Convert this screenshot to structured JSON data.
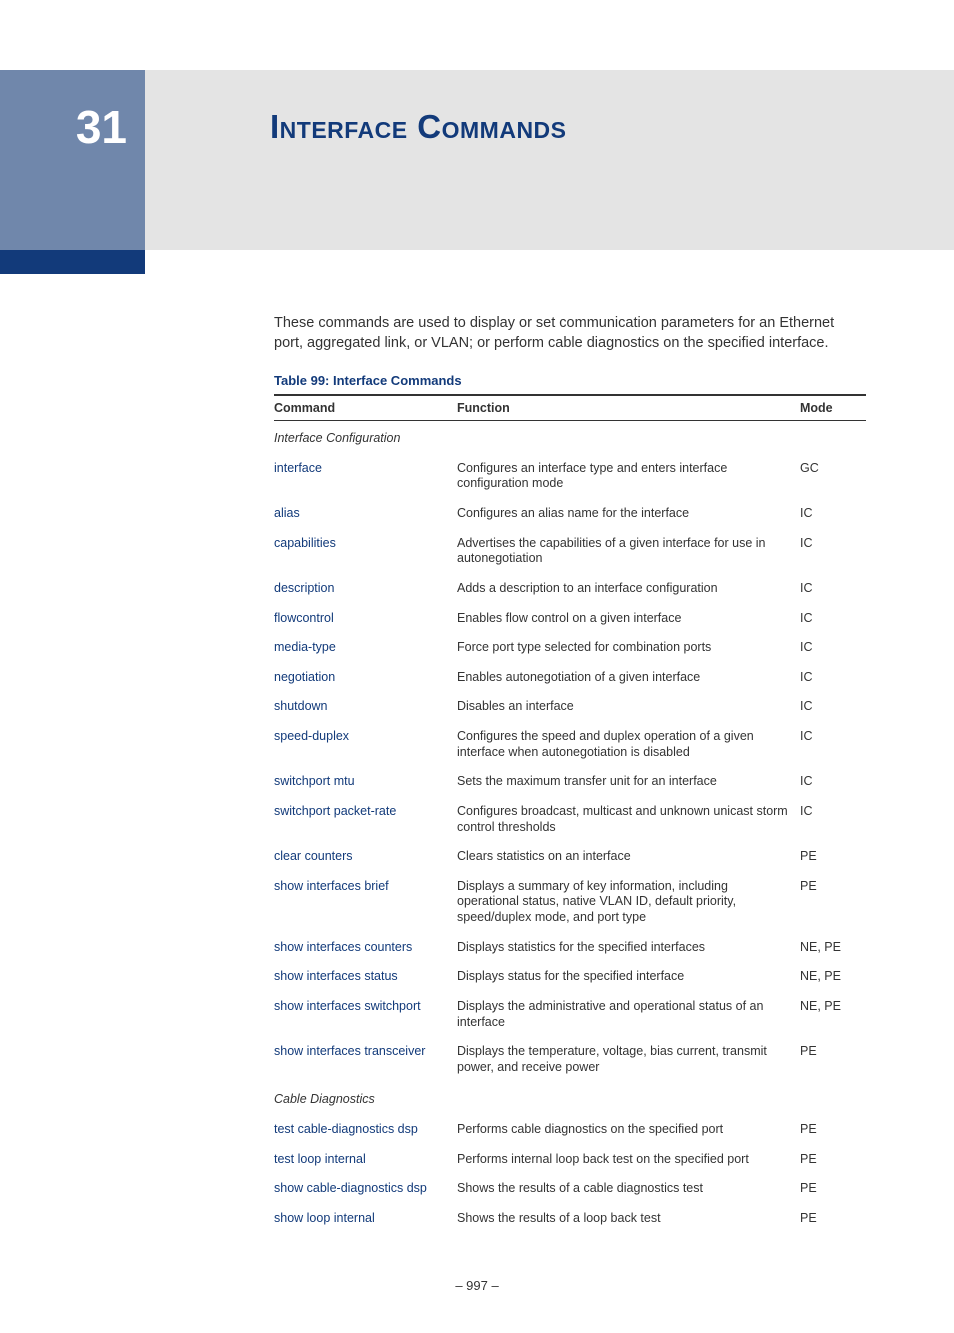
{
  "chapter": {
    "number": "31",
    "title": "Interface Commands"
  },
  "intro": "These commands are used to display or set communication parameters for an Ethernet port, aggregated link, or VLAN; or perform cable diagnostics on the specified interface.",
  "table": {
    "caption": "Table 99: Interface Commands",
    "headers": {
      "command": "Command",
      "function": "Function",
      "mode": "Mode"
    },
    "sections": [
      {
        "title": "Interface Configuration",
        "rows": [
          {
            "command": "interface",
            "function": "Configures an interface type and enters interface configuration mode",
            "mode": "GC"
          },
          {
            "command": "alias",
            "function": "Configures an alias name for the interface",
            "mode": "IC"
          },
          {
            "command": "capabilities",
            "function": "Advertises the capabilities of a given interface for use in autonegotiation",
            "mode": "IC"
          },
          {
            "command": "description",
            "function": "Adds a description to an interface configuration",
            "mode": "IC"
          },
          {
            "command": "flowcontrol",
            "function": "Enables flow control on a given interface",
            "mode": "IC"
          },
          {
            "command": "media-type",
            "function": "Force port type selected for combination ports",
            "mode": "IC"
          },
          {
            "command": "negotiation",
            "function": "Enables autonegotiation of a given interface",
            "mode": "IC"
          },
          {
            "command": "shutdown",
            "function": "Disables an interface",
            "mode": "IC"
          },
          {
            "command": "speed-duplex",
            "function": "Configures the speed and duplex operation of a given interface when autonegotiation is disabled",
            "mode": "IC"
          },
          {
            "command": "switchport mtu",
            "function": "Sets the maximum transfer unit for an interface",
            "mode": "IC"
          },
          {
            "command": "switchport packet-rate",
            "function": "Configures broadcast, multicast and unknown unicast storm control thresholds",
            "mode": "IC"
          },
          {
            "command": "clear counters",
            "function": "Clears statistics on an interface",
            "mode": "PE"
          },
          {
            "command": "show interfaces brief",
            "function": "Displays a summary of key information, including operational status, native VLAN ID, default priority, speed/duplex mode, and port type",
            "mode": "PE"
          },
          {
            "command": "show interfaces counters",
            "function": "Displays statistics for the specified interfaces",
            "mode": "NE, PE"
          },
          {
            "command": "show interfaces status",
            "function": "Displays status for the specified interface",
            "mode": "NE, PE"
          },
          {
            "command": "show interfaces switchport",
            "function": "Displays the administrative and operational status of an interface",
            "mode": "NE, PE"
          },
          {
            "command": "show interfaces transceiver",
            "function": "Displays the temperature, voltage, bias current, transmit power, and receive power",
            "mode": "PE"
          }
        ]
      },
      {
        "title": "Cable Diagnostics",
        "rows": [
          {
            "command": "test cable-diagnostics dsp",
            "function": "Performs cable diagnostics on the specified port",
            "mode": "PE"
          },
          {
            "command": "test loop internal",
            "function": "Performs internal loop back test on the specified port",
            "mode": "PE"
          },
          {
            "command": "show cable-diagnostics dsp",
            "function": "Shows the results of a cable diagnostics test",
            "mode": "PE"
          },
          {
            "command": "show loop internal",
            "function": "Shows the results of a loop back test",
            "mode": "PE"
          }
        ]
      }
    ]
  },
  "footer": {
    "page": "–  997  –"
  }
}
